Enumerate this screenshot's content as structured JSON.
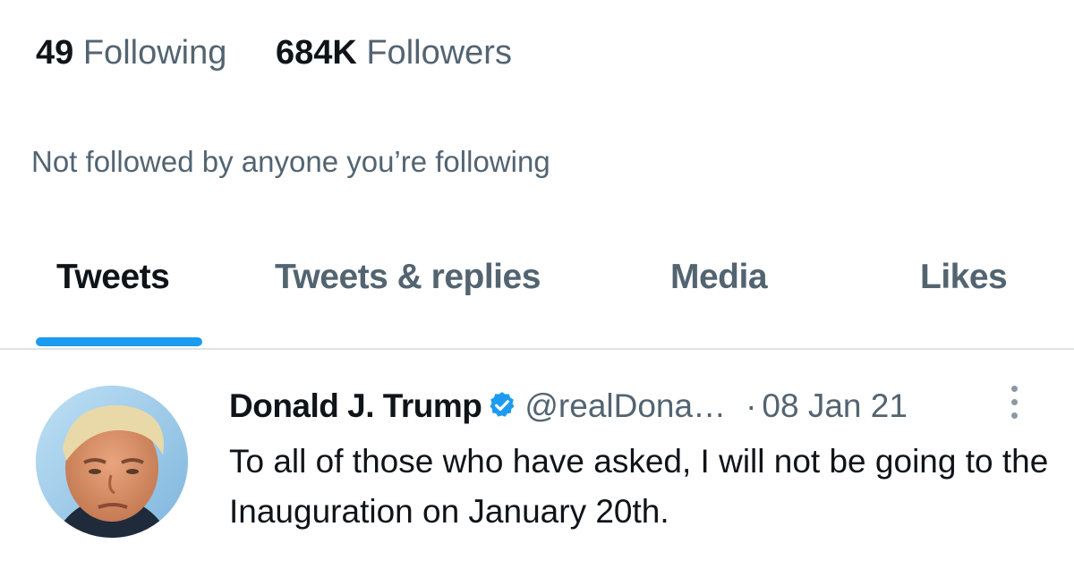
{
  "profile": {
    "following_count": "49",
    "following_label": "Following",
    "followers_count": "684K",
    "followers_label": "Followers",
    "not_followed_text": "Not followed by anyone you’re following"
  },
  "tabs": [
    {
      "label": "Tweets",
      "active": true
    },
    {
      "label": "Tweets & replies",
      "active": false
    },
    {
      "label": "Media",
      "active": false
    },
    {
      "label": "Likes",
      "active": false
    }
  ],
  "tweet": {
    "author_name": "Donald J. Trump",
    "handle": "@realDona…",
    "separator": "·",
    "date": "08 Jan 21",
    "text": "To all of those who have asked, I will not be going to the Inauguration on January 20th.",
    "verified": true
  },
  "icons": {
    "verified": "verified-badge-icon",
    "more": "more-options-icon"
  },
  "colors": {
    "accent": "#1d9bf0",
    "secondary_text": "#536471",
    "primary_text": "#0f1419",
    "divider": "#dfe3e6"
  }
}
